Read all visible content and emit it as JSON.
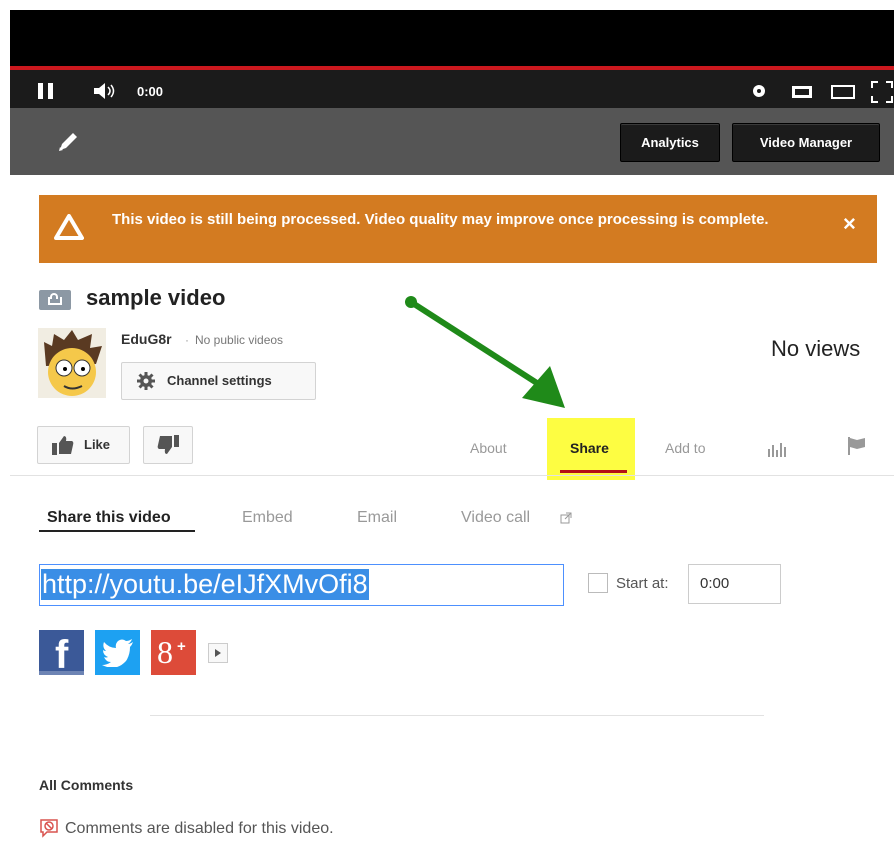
{
  "player": {
    "time": "0:00"
  },
  "owner_bar": {
    "analytics_label": "Analytics",
    "video_manager_label": "Video Manager"
  },
  "banner": {
    "message": "This video is still being processed. Video quality may improve once processing is complete.",
    "close": "×",
    "color": "#d37b21"
  },
  "video": {
    "title": "sample video",
    "channel": "EduG8r",
    "channel_note": "No public videos",
    "views": "No views"
  },
  "buttons": {
    "channel_settings": "Channel settings",
    "like": "Like"
  },
  "tabs": {
    "about": "About",
    "share": "Share",
    "add_to": "Add to"
  },
  "share": {
    "subtabs": {
      "share_this_video": "Share this video",
      "embed": "Embed",
      "email": "Email",
      "video_call": "Video call"
    },
    "url": "http://youtu.be/eIJfXMvOfi8",
    "start_at_label": "Start at:",
    "start_at_value": "0:00"
  },
  "social": {
    "facebook": "f",
    "googleplus": "8",
    "googleplus_sup": "+"
  },
  "comments": {
    "heading": "All Comments",
    "disabled": "Comments are disabled for this video."
  },
  "colors": {
    "highlight": "#fdfd42",
    "arrow": "#1f8a19",
    "accent_red": "#cc181e"
  }
}
